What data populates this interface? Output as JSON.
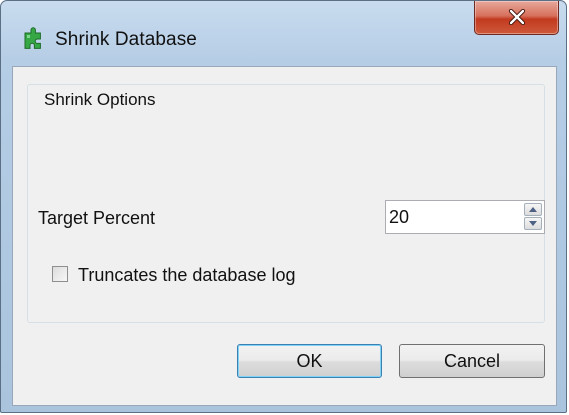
{
  "window": {
    "title": "Shrink Database"
  },
  "titlebar": {
    "app_icon": "puzzle-piece-icon",
    "close_icon": "close-icon"
  },
  "group": {
    "legend": "Shrink Options"
  },
  "target_percent": {
    "label": "Target Percent",
    "value": "20",
    "spin_up_icon": "arrow-up-icon",
    "spin_down_icon": "arrow-down-icon"
  },
  "truncate_log": {
    "label": "Truncates the database log",
    "checked": false
  },
  "buttons": {
    "ok_label": "OK",
    "cancel_label": "Cancel"
  },
  "colors": {
    "close_button": "#c9442a",
    "default_button_border": "#3c7fb1",
    "app_icon": "#2e9e3a"
  }
}
